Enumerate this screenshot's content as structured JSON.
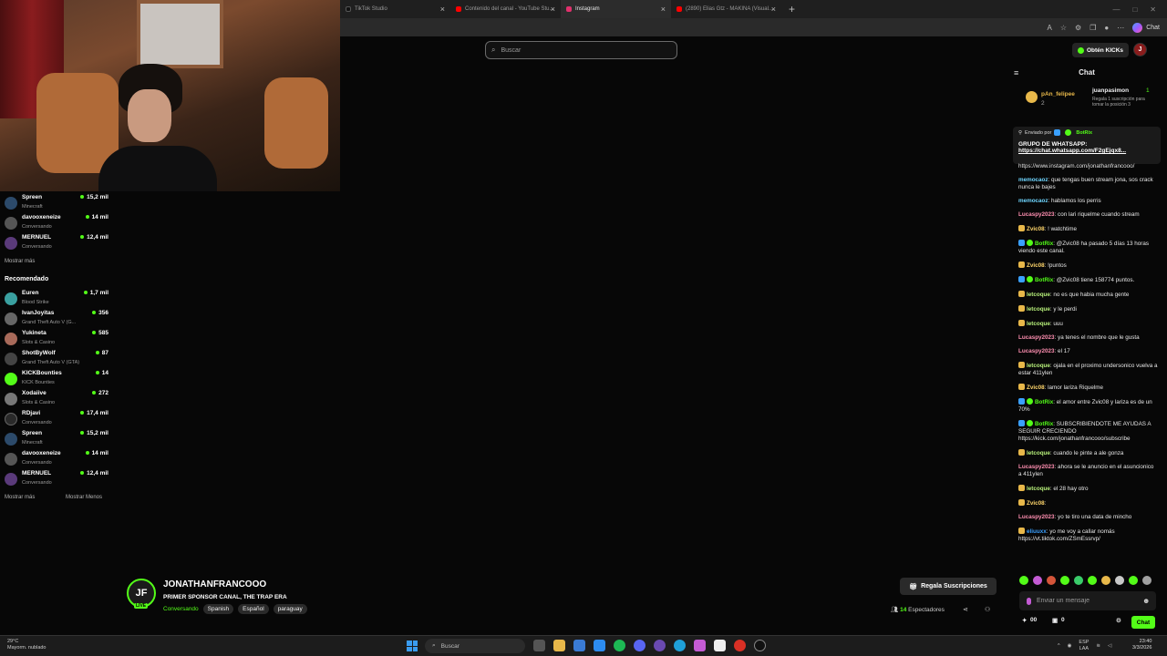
{
  "browser": {
    "tabs": [
      {
        "label": "TikTok Studio",
        "color": "#111111"
      },
      {
        "label": "Contenido del canal - YouTube Stu...",
        "color": "#ff0000"
      },
      {
        "label": "Instagram",
        "color": "#e1306c"
      },
      {
        "label": "(2890) Elias Gtz - MAKINA (Visual...",
        "color": "#ff0000"
      }
    ],
    "chat_button": "Chat"
  },
  "header": {
    "search_placeholder": "Buscar",
    "kicks_button": "Obtén KICKs",
    "profile_initial": "J"
  },
  "sidebar": {
    "following": [
      {
        "name": "Spreen",
        "category": "Minecraft",
        "viewers": "15,2 mil"
      },
      {
        "name": "davooxeneize",
        "category": "Conversando",
        "viewers": "14 mil"
      },
      {
        "name": "MERNUEL",
        "category": "Conversando",
        "viewers": "12,4 mil"
      }
    ],
    "show_more_1": "Mostrar más",
    "recommended_title": "Recomendado",
    "recommended": [
      {
        "name": "Euren",
        "category": "Blood Strike",
        "viewers": "1,7 mil"
      },
      {
        "name": "IvanJoyitas",
        "category": "Grand Theft Auto V (G...",
        "viewers": "356"
      },
      {
        "name": "Yukineta",
        "category": "Slots & Casino",
        "viewers": "585"
      },
      {
        "name": "ShotByWolf",
        "category": "Grand Theft Auto V (GTA)",
        "viewers": "87"
      },
      {
        "name": "KICKBounties",
        "category": "KICK Bounties",
        "viewers": "14"
      },
      {
        "name": "Xodaiive",
        "category": "Slots & Casino",
        "viewers": "272"
      },
      {
        "name": "RDjavi",
        "category": "Conversando",
        "viewers": "17,4 mil"
      },
      {
        "name": "Spreen",
        "category": "Minecraft",
        "viewers": "15,2 mil"
      },
      {
        "name": "davooxeneize",
        "category": "Conversando",
        "viewers": "14 mil"
      },
      {
        "name": "MERNUEL",
        "category": "Conversando",
        "viewers": "12,4 mil"
      }
    ],
    "show_more_2": "Mostrar más",
    "show_less": "Mostrar Menos"
  },
  "chat": {
    "title": "Chat",
    "leaders": {
      "first_name": "pAn_felipee",
      "first_count": "2",
      "second_name": "juanpasimon",
      "second_count": "1",
      "second_sub": "Regala 1 suscripción para tomar la posición 3"
    },
    "pinned": {
      "sent_by_label": "Enviado por",
      "sender": "BotRix",
      "message": "GRUPO DE WHATSAPP:",
      "link": "https://chat.whatsapp.com/F2gEjqx8..."
    },
    "messages": [
      {
        "user": "",
        "text": "https://www.instagram.com/jonathanfrancooo/",
        "color": "#e8e8e8",
        "badge": ""
      },
      {
        "user": "memocaoz",
        "text": ": que tengas buen stream jona, sos crack nunca le bajes",
        "color": "#6fd6ff",
        "badge": ""
      },
      {
        "user": "memocaoz",
        "text": ": hablamos los perris",
        "color": "#6fd6ff",
        "badge": ""
      },
      {
        "user": "Lucaspy2023",
        "text": ": con lari riquelme cuando stream",
        "color": "#ff8fb1",
        "badge": ""
      },
      {
        "user": "Zvic08",
        "text": ": ! watchtime",
        "color": "#ffd66b",
        "badge": "crown"
      },
      {
        "user": "BotRix",
        "text": ": @Zvic08 ha pasado 5 días 13 horas viendo este canal.",
        "color": "#53fc18",
        "badge": "bot"
      },
      {
        "user": "Zvic08",
        "text": ": !puntos",
        "color": "#ffd66b",
        "badge": "crown"
      },
      {
        "user": "BotRix",
        "text": ": @Zvic08 tiene 158774 puntos.",
        "color": "#53fc18",
        "badge": "bot"
      },
      {
        "user": "letcoque",
        "text": ": no es que habia mucha gente",
        "color": "#b7f07a",
        "badge": "crown"
      },
      {
        "user": "letcoque",
        "text": ": y le perdi",
        "color": "#b7f07a",
        "badge": "crown"
      },
      {
        "user": "letcoque",
        "text": ": uuu",
        "color": "#b7f07a",
        "badge": "crown"
      },
      {
        "user": "Lucaspy2023",
        "text": ": ya tenes el nombre que le gusta",
        "color": "#ff8fb1",
        "badge": ""
      },
      {
        "user": "Lucaspy2023",
        "text": ": el 17",
        "color": "#ff8fb1",
        "badge": ""
      },
      {
        "user": "letcoque",
        "text": ": ojala en el proximo undersonico vuelva a estar 411ylen",
        "color": "#b7f07a",
        "badge": "crown"
      },
      {
        "user": "Zvic08",
        "text": ": lamor lariza Riquelme",
        "color": "#ffd66b",
        "badge": "crown"
      },
      {
        "user": "BotRix",
        "text": ": el amor entre Zvic08 y lariza es de un 70%",
        "color": "#53fc18",
        "badge": "bot"
      },
      {
        "user": "BotRix",
        "text": ": SUBSCRIBIENDOTE ME AYUDAS A SEGUIR CRECIENDO https://kick.com/jonathanfrancooo/subscribe",
        "color": "#53fc18",
        "badge": "bot"
      },
      {
        "user": "letcoque",
        "text": ": cuando le pinte a ale gonza",
        "color": "#b7f07a",
        "badge": "crown"
      },
      {
        "user": "Lucaspy2023",
        "text": ": ahora se le anuncio en el asuncionico a 411ylen",
        "color": "#ff8fb1",
        "badge": ""
      },
      {
        "user": "letcoque",
        "text": ": el 28 hay otro",
        "color": "#b7f07a",
        "badge": "crown"
      },
      {
        "user": "Zvic08",
        "text": ": ",
        "color": "#ffd66b",
        "badge": "crown"
      },
      {
        "user": "Lucaspy2023",
        "text": ": yo te tiro una data de mincho",
        "color": "#ff8fb1",
        "badge": ""
      },
      {
        "user": "eliuuxx",
        "text": ": yo me voy a callar nomás https://vt.tiktok.com/ZSmEssrvp/",
        "color": "#3aa0ff",
        "badge": "crown"
      }
    ],
    "input_placeholder": "Enviar un mensaje",
    "points": "00",
    "subs_count": "0",
    "send_button": "Chat"
  },
  "stream": {
    "avatar_text": "JF",
    "live_badge": "LIVE",
    "streamer": "JONATHANFRANCOOO",
    "title": "PRIMER SPONSOR CANAL, THE TRAP ERA",
    "category": "Conversando",
    "tags": [
      "Spanish",
      "Español",
      "paraguay"
    ],
    "gift_button": "Regala Suscripciones",
    "viewer_count": "14",
    "viewer_label": "Espectadores"
  },
  "taskbar": {
    "temperature": "29°C",
    "weather": "Mayorm. nublado",
    "search": "Buscar",
    "lang": "ESP",
    "region": "LAA",
    "time": "23:40",
    "date": "3/3/2026"
  }
}
